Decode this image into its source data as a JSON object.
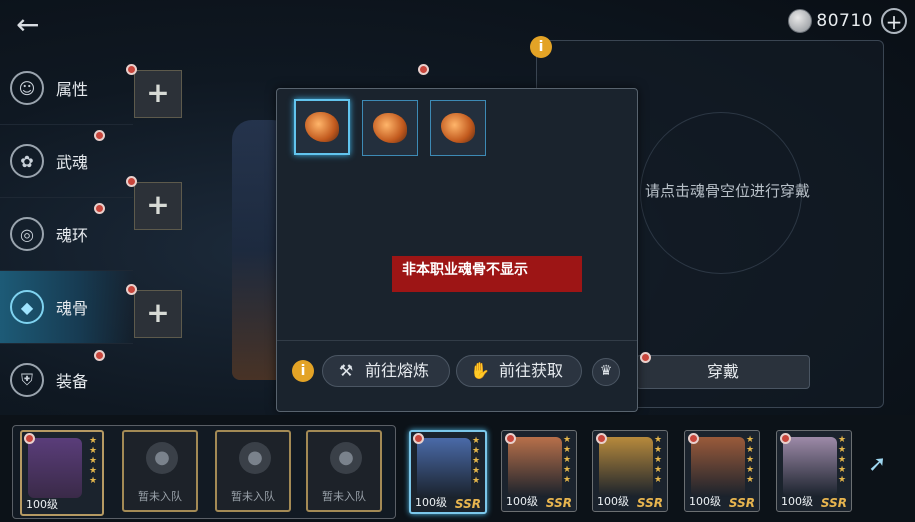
{
  "header": {
    "coin_value": "80710",
    "plus": "+"
  },
  "sidebar": {
    "items": [
      {
        "label": "属性",
        "icon": "attribute-icon"
      },
      {
        "label": "武魂",
        "icon": "martial-soul-icon"
      },
      {
        "label": "魂环",
        "icon": "soul-ring-icon"
      },
      {
        "label": "魂骨",
        "icon": "soul-bone-icon",
        "active": true
      },
      {
        "label": "装备",
        "icon": "equipment-icon"
      }
    ]
  },
  "equip_panel": {
    "hint": "，请点击魂骨空位进行穿戴",
    "equip_label": "穿戴"
  },
  "popup": {
    "notice": "非本职业魂骨不显示",
    "smelt_label": "前往熔炼",
    "obtain_label": "前往获取"
  },
  "team": {
    "lead": {
      "level": "100级"
    },
    "empty_label": "暂未入队"
  },
  "roster": [
    {
      "level": "100级",
      "rarity": "SSR",
      "color": "#4a6aa8"
    },
    {
      "level": "100级",
      "rarity": "SSR",
      "color": "#b8704a"
    },
    {
      "level": "100级",
      "rarity": "SSR",
      "color": "#b78a3c"
    },
    {
      "level": "100级",
      "rarity": "SSR",
      "color": "#9a5a3a"
    },
    {
      "level": "100级",
      "rarity": "SSR",
      "color": "#9d8aa8"
    }
  ],
  "info_symbol": "i"
}
